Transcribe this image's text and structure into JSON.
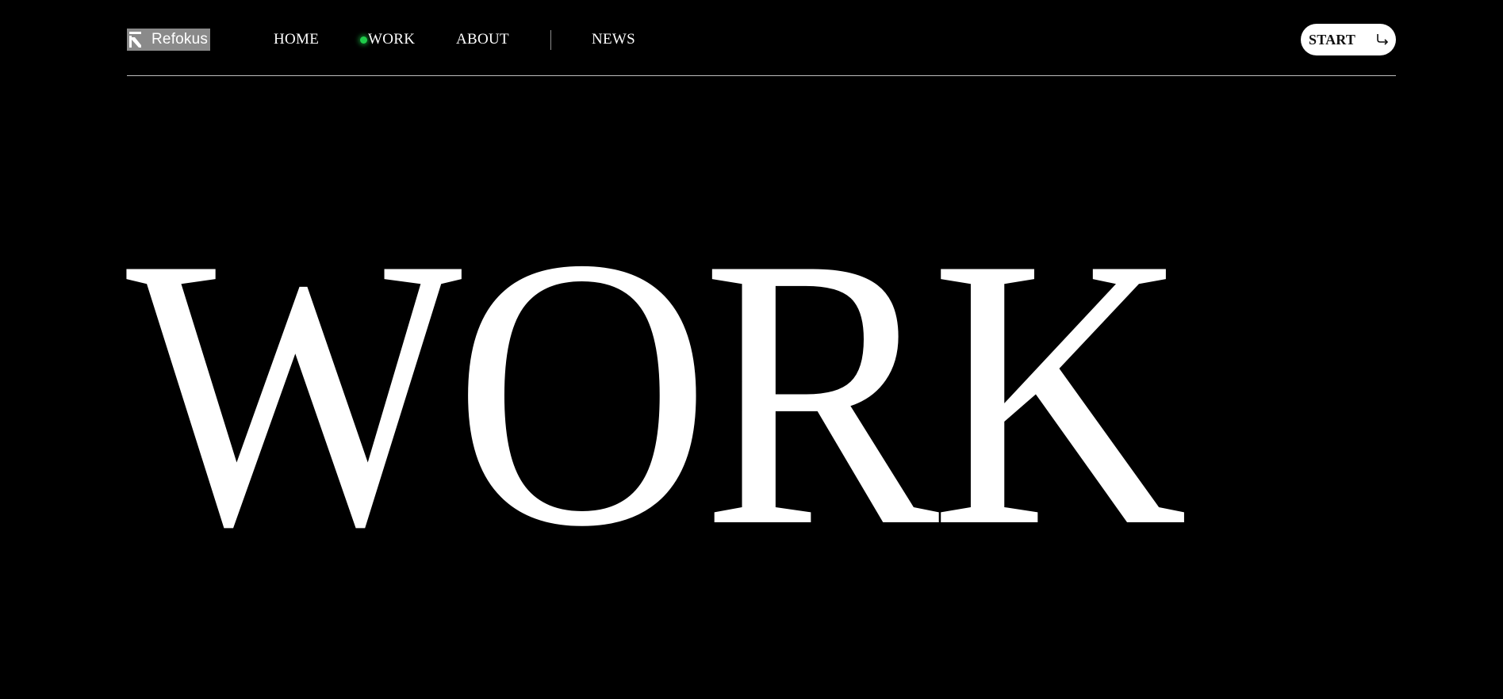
{
  "brand": {
    "name": "Refokus",
    "icon": "refokus-logo-icon"
  },
  "nav": {
    "items": [
      {
        "label": "HOME"
      },
      {
        "label": "WORK",
        "active": true
      },
      {
        "label": "ABOUT"
      },
      {
        "label": "NEWS"
      }
    ]
  },
  "cta": {
    "label": "START",
    "icon": "arrow-return-icon"
  },
  "hero": {
    "title": "WORK"
  },
  "colors": {
    "background": "#000000",
    "text": "#ffffff",
    "active_indicator": "#1fcc4a",
    "logo_highlight": "#8a8a8a"
  }
}
